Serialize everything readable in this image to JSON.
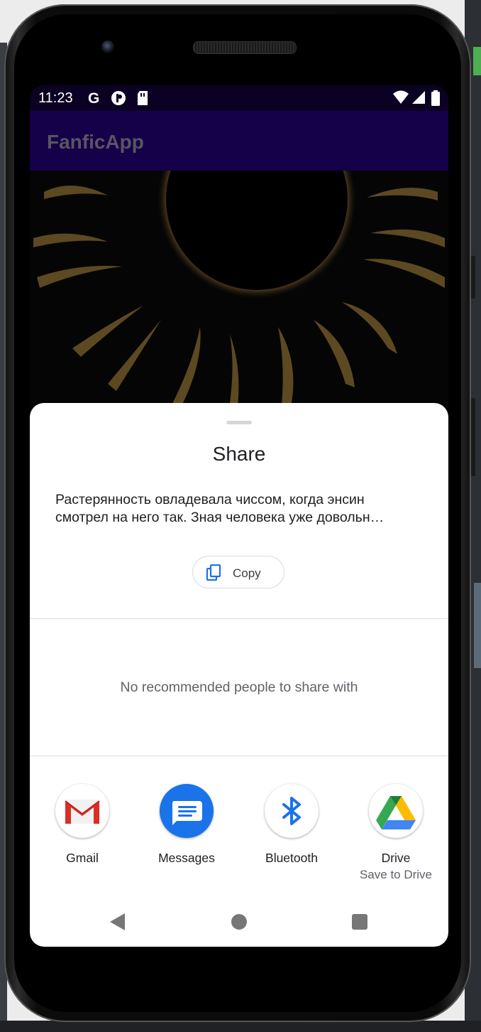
{
  "status_bar": {
    "time": "11:23",
    "icons_left": [
      "google-g-icon",
      "record-icon",
      "sd-card-icon"
    ],
    "icons_right": [
      "wifi-icon",
      "signal-icon",
      "battery-icon"
    ]
  },
  "app_bar": {
    "title": "FanficApp"
  },
  "share_sheet": {
    "title": "Share",
    "preview_lines": [
      "Растерянность овладевала чиссом, когда энсин",
      "смотрел на него так. Зная человека уже довольн…"
    ],
    "copy_label": "Copy",
    "no_people_text": "No recommended people to share with",
    "targets": [
      {
        "label": "Gmail",
        "sublabel": "",
        "icon": "gmail-icon"
      },
      {
        "label": "Messages",
        "sublabel": "",
        "icon": "messages-icon"
      },
      {
        "label": "Bluetooth",
        "sublabel": "",
        "icon": "bluetooth-icon"
      },
      {
        "label": "Drive",
        "sublabel": "Save to Drive",
        "icon": "drive-icon"
      }
    ]
  },
  "colors": {
    "status_bar_bg": "#0b0223",
    "app_bar_bg": "#15004a",
    "sheet_bg": "#ffffff",
    "messages_blue": "#1a73e8",
    "bluetooth_blue": "#1a73e8"
  }
}
